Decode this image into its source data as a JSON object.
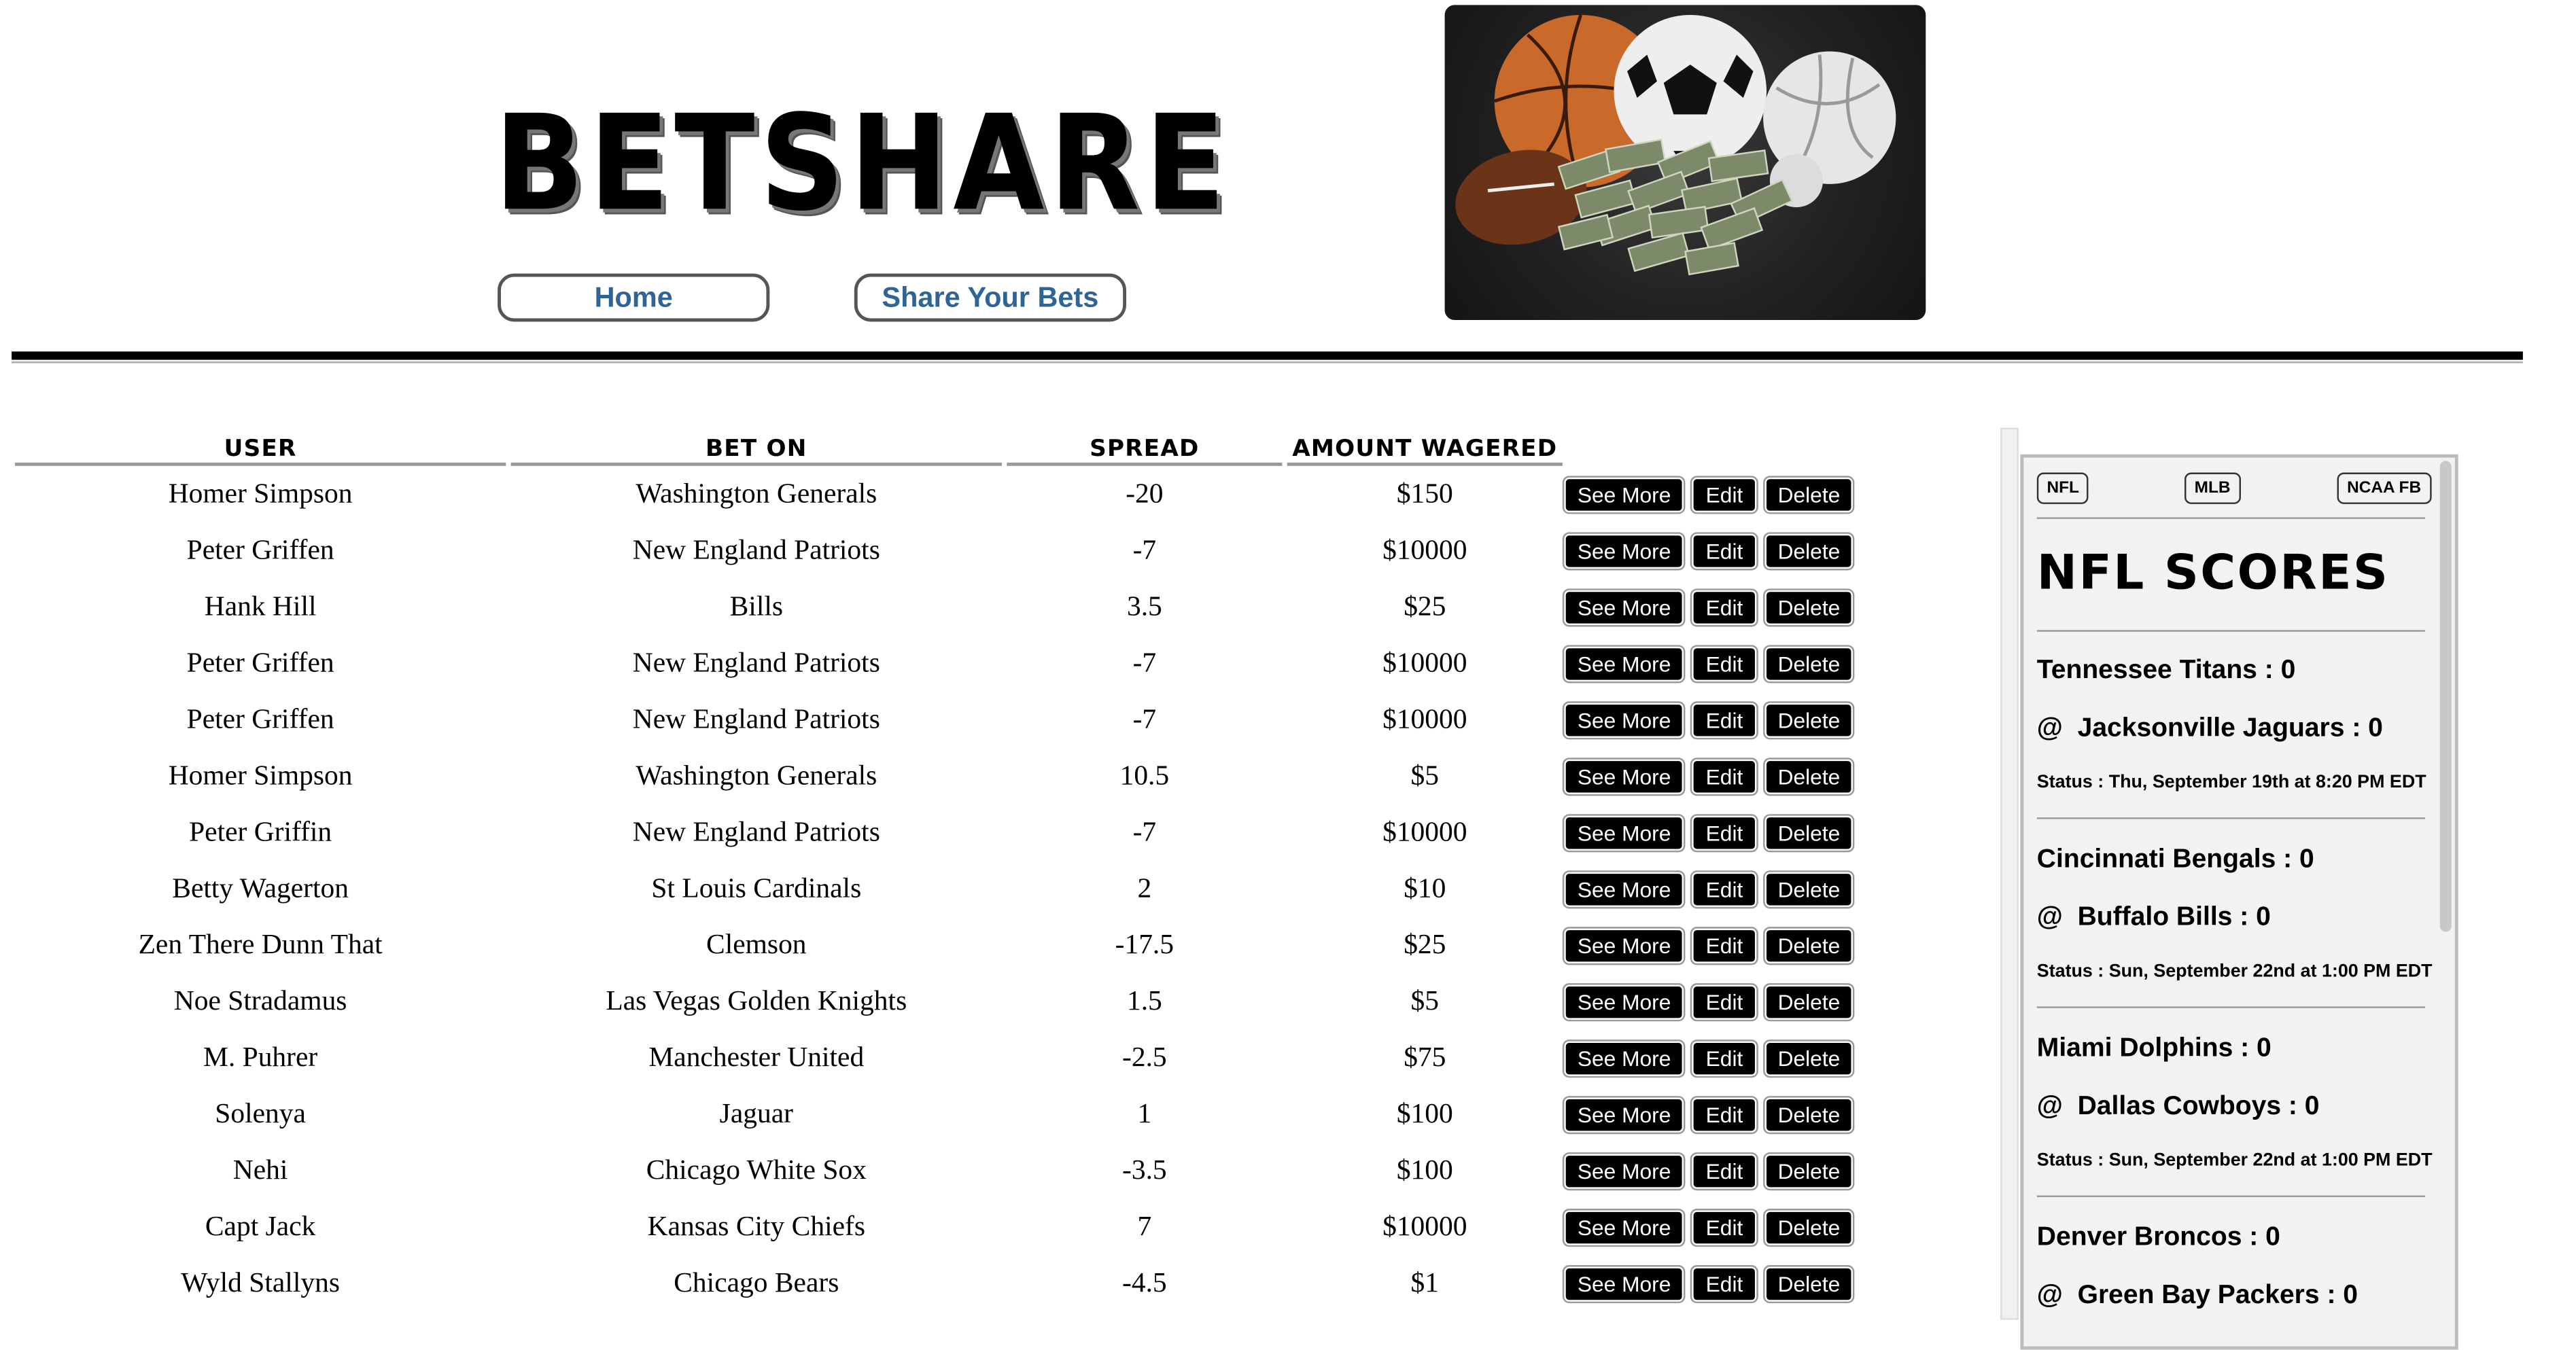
{
  "header": {
    "title": "BETSHARE",
    "nav": [
      {
        "label": "Home"
      },
      {
        "label": "Share Your Bets"
      }
    ]
  },
  "table": {
    "headers": {
      "user": "USER",
      "bet_on": "BET ON",
      "spread": "SPREAD",
      "amount": "AMOUNT WAGERED"
    },
    "actions": {
      "see_more": "See More",
      "edit": "Edit",
      "delete": "Delete"
    },
    "rows": [
      {
        "user": "Homer Simpson",
        "bet_on": "Washington Generals",
        "spread": "-20",
        "amount": "$150"
      },
      {
        "user": "Peter Griffen",
        "bet_on": "New England Patriots",
        "spread": "-7",
        "amount": "$10000"
      },
      {
        "user": "Hank Hill",
        "bet_on": "Bills",
        "spread": "3.5",
        "amount": "$25"
      },
      {
        "user": "Peter Griffen",
        "bet_on": "New England Patriots",
        "spread": "-7",
        "amount": "$10000"
      },
      {
        "user": "Peter Griffen",
        "bet_on": "New England Patriots",
        "spread": "-7",
        "amount": "$10000"
      },
      {
        "user": "Homer Simpson",
        "bet_on": "Washington Generals",
        "spread": "10.5",
        "amount": "$5"
      },
      {
        "user": "Peter Griffin",
        "bet_on": "New England Patriots",
        "spread": "-7",
        "amount": "$10000"
      },
      {
        "user": "Betty Wagerton",
        "bet_on": "St Louis Cardinals",
        "spread": "2",
        "amount": "$10"
      },
      {
        "user": "Zen There Dunn That",
        "bet_on": "Clemson",
        "spread": "-17.5",
        "amount": "$25"
      },
      {
        "user": "Noe Stradamus",
        "bet_on": "Las Vegas Golden Knights",
        "spread": "1.5",
        "amount": "$5"
      },
      {
        "user": "M. Puhrer",
        "bet_on": "Manchester United",
        "spread": "-2.5",
        "amount": "$75"
      },
      {
        "user": "Solenya",
        "bet_on": "Jaguar",
        "spread": "1",
        "amount": "$100"
      },
      {
        "user": "Nehi",
        "bet_on": "Chicago White Sox",
        "spread": "-3.5",
        "amount": "$100"
      },
      {
        "user": "Capt Jack",
        "bet_on": "Kansas City Chiefs",
        "spread": "7",
        "amount": "$10000"
      },
      {
        "user": "Wyld Stallyns",
        "bet_on": "Chicago Bears",
        "spread": "-4.5",
        "amount": "$1"
      }
    ]
  },
  "scores": {
    "tabs": [
      "NFL",
      "MLB",
      "NCAA FB"
    ],
    "title": "NFL SCORES",
    "games": [
      {
        "away": "Tennessee Titans : 0",
        "home": "Jacksonville Jaguars : 0",
        "status": "Status : Thu, September 19th at 8:20 PM EDT"
      },
      {
        "away": "Cincinnati Bengals : 0",
        "home": "Buffalo Bills : 0",
        "status": "Status : Sun, September 22nd at 1:00 PM EDT"
      },
      {
        "away": "Miami Dolphins : 0",
        "home": "Dallas Cowboys : 0",
        "status": "Status : Sun, September 22nd at 1:00 PM EDT"
      },
      {
        "away": "Denver Broncos : 0",
        "home": "Green Bay Packers : 0",
        "status": ""
      }
    ],
    "at_symbol": "@"
  },
  "colors": {
    "nav_text": "#2f6497",
    "button_bg": "#000000",
    "panel_bg": "#f2f2f2"
  },
  "icons": {
    "hero": "sports-balls-money-image"
  }
}
